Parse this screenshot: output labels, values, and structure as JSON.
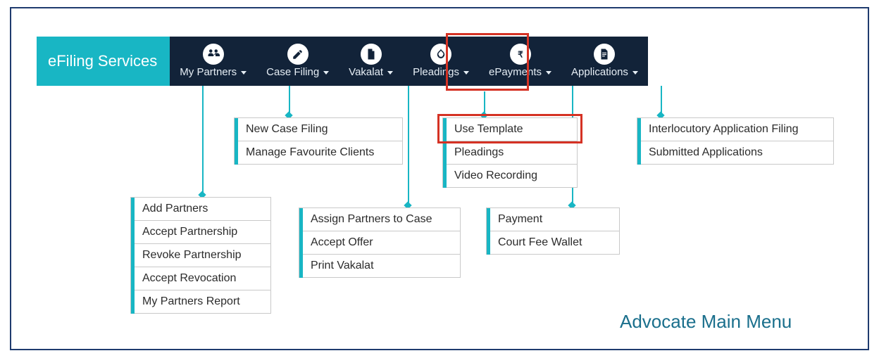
{
  "brand": "eFiling Services",
  "nav": {
    "items": [
      {
        "label": "My Partners",
        "icon": "partners"
      },
      {
        "label": "Case Filing",
        "icon": "pencil"
      },
      {
        "label": "Vakalat",
        "icon": "file"
      },
      {
        "label": "Pleadings",
        "icon": "hands"
      },
      {
        "label": "ePayments",
        "icon": "rupee"
      },
      {
        "label": "Applications",
        "icon": "doc"
      }
    ]
  },
  "dropdowns": {
    "myPartners": {
      "items": [
        "Add Partners",
        "Accept Partnership",
        "Revoke Partnership",
        "Accept Revocation",
        "My Partners Report"
      ]
    },
    "caseFiling": {
      "items": [
        "New Case Filing",
        "Manage Favourite Clients"
      ]
    },
    "vakalat": {
      "items": [
        "Assign Partners to Case",
        "Accept Offer",
        "Print Vakalat"
      ]
    },
    "pleadings": {
      "items": [
        "Use Template",
        "Pleadings",
        "Video Recording"
      ]
    },
    "epayments": {
      "items": [
        "Payment",
        "Court Fee Wallet"
      ]
    },
    "applications": {
      "items": [
        "Interlocutory Application Filing",
        "Submitted Applications"
      ]
    }
  },
  "caption": "Advocate Main Menu",
  "colors": {
    "accent": "#18b6c4",
    "navBg": "#122339",
    "highlight": "#d53224",
    "frame": "#1f3b6e"
  }
}
